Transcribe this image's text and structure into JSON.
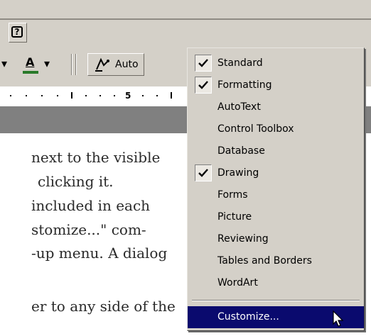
{
  "toolbar": {
    "help_glyph": "?",
    "font_color_glyph": "A",
    "dropdown_glyph": "▾",
    "autoshapes_label": "Auto",
    "ruler_number": "5"
  },
  "document": {
    "lines": [
      "next to the visible",
      "clicking it.",
      "included in each",
      "stomize...\" com-",
      "-up menu. A dialog",
      "er to any side of the"
    ]
  },
  "context_menu": {
    "items": [
      {
        "label": "Standard",
        "checked": true
      },
      {
        "label": "Formatting",
        "checked": true
      },
      {
        "label": "AutoText",
        "checked": false
      },
      {
        "label": "Control Toolbox",
        "checked": false
      },
      {
        "label": "Database",
        "checked": false
      },
      {
        "label": "Drawing",
        "checked": true
      },
      {
        "label": "Forms",
        "checked": false
      },
      {
        "label": "Picture",
        "checked": false
      },
      {
        "label": "Reviewing",
        "checked": false
      },
      {
        "label": "Tables and Borders",
        "checked": false
      },
      {
        "label": "WordArt",
        "checked": false
      }
    ],
    "customize_label": "Customize..."
  },
  "colors": {
    "chrome": "#d4d0c8",
    "highlight": "#0a0a6e",
    "font_color_bar": "#2a7a2a"
  }
}
